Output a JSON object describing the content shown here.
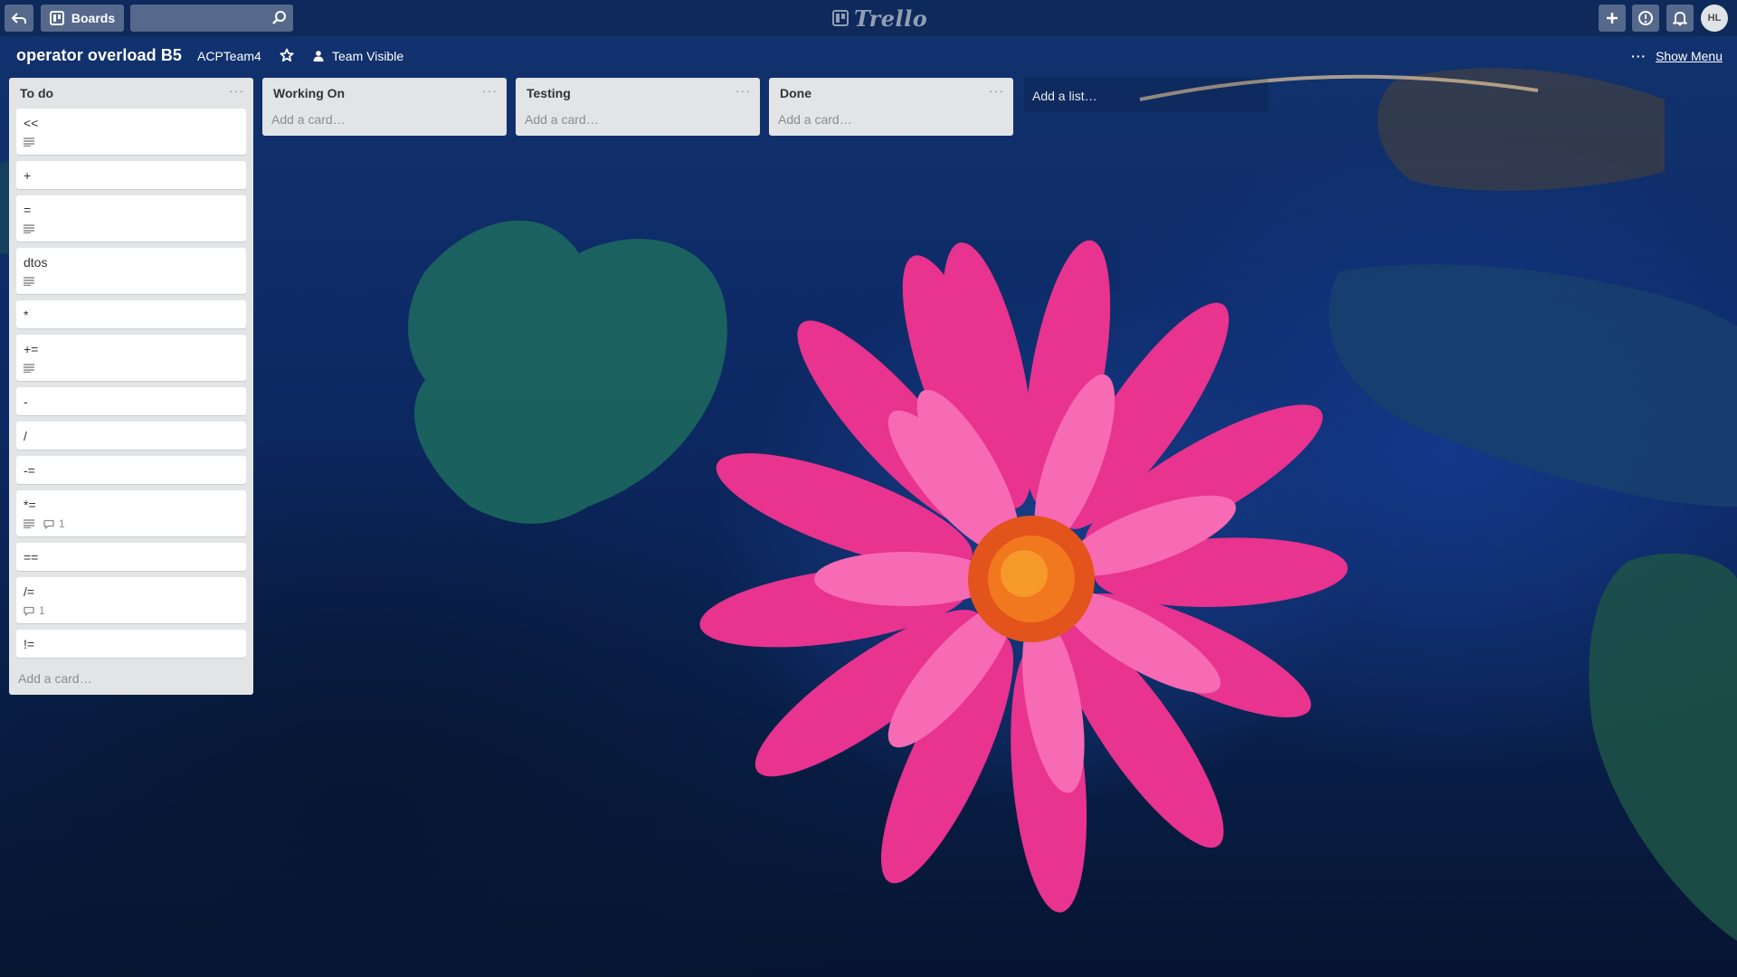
{
  "header": {
    "boards_label": "Boards",
    "search_placeholder": "",
    "logo_text": "Trello",
    "avatar_initials": "HL"
  },
  "board": {
    "title": "operator overload B5",
    "team": "ACPTeam4",
    "visibility": "Team Visible",
    "show_menu": "Show Menu"
  },
  "lists": [
    {
      "title": "To do",
      "cards": [
        {
          "text": "<<",
          "description": true,
          "comments": ""
        },
        {
          "text": "+",
          "description": false,
          "comments": ""
        },
        {
          "text": "=",
          "description": true,
          "comments": ""
        },
        {
          "text": "dtos",
          "description": true,
          "comments": ""
        },
        {
          "text": "*",
          "description": false,
          "comments": ""
        },
        {
          "text": "+=",
          "description": true,
          "comments": ""
        },
        {
          "text": "-",
          "description": false,
          "comments": ""
        },
        {
          "text": "/",
          "description": false,
          "comments": ""
        },
        {
          "text": "-=",
          "description": false,
          "comments": ""
        },
        {
          "text": "*=",
          "description": true,
          "comments": "1"
        },
        {
          "text": "==",
          "description": false,
          "comments": ""
        },
        {
          "text": "/=",
          "description": false,
          "comments": "1"
        },
        {
          "text": "!=",
          "description": false,
          "comments": ""
        }
      ],
      "add_card": "Add a card…"
    },
    {
      "title": "Working On",
      "cards": [],
      "add_card": "Add a card…"
    },
    {
      "title": "Testing",
      "cards": [],
      "add_card": "Add a card…"
    },
    {
      "title": "Done",
      "cards": [],
      "add_card": "Add a card…"
    }
  ],
  "add_list": "Add a list…",
  "colors": {
    "list_bg": "#e2e4e6",
    "card_bg": "#ffffff",
    "header_btn": "rgba(255,255,255,0.3)"
  }
}
